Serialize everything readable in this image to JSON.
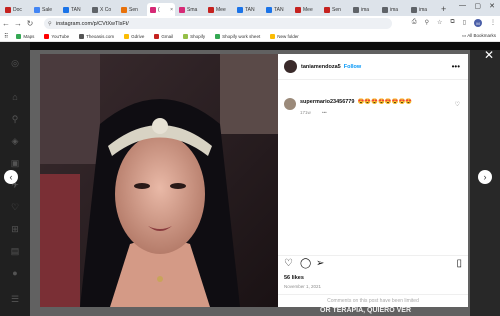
{
  "browser": {
    "tabs": [
      {
        "label": "Doc",
        "color": "#c5221f"
      },
      {
        "label": "Sale",
        "color": "#4285f4"
      },
      {
        "label": "TAN",
        "color": "#1a73e8"
      },
      {
        "label": "X Co",
        "color": "#5f6368"
      },
      {
        "label": "Sen",
        "color": "#e8710a"
      },
      {
        "label": "(",
        "color": "#d62976",
        "active": true,
        "x": "×"
      },
      {
        "label": "Sma",
        "color": "#d62976"
      },
      {
        "label": "Mee",
        "color": "#c5221f"
      },
      {
        "label": "TAN",
        "color": "#1a73e8"
      },
      {
        "label": "TAN",
        "color": "#1a73e8"
      },
      {
        "label": "Mee",
        "color": "#c5221f"
      },
      {
        "label": "Sen",
        "color": "#c5221f"
      },
      {
        "label": "ima",
        "color": "#5f6368"
      },
      {
        "label": "ima",
        "color": "#5f6368"
      },
      {
        "label": "ima",
        "color": "#5f6368"
      }
    ],
    "url": "instagram.com/p/CVtXwTlsFt/",
    "bookmarks": [
      {
        "label": "Maps",
        "color": "#34a853"
      },
      {
        "label": "YouTube",
        "color": "#ff0000"
      },
      {
        "label": "Theoasis.com",
        "color": "#555"
      },
      {
        "label": "Gdrive",
        "color": "#fbbc04"
      },
      {
        "label": "Gmail",
        "color": "#c5221f"
      },
      {
        "label": "Shopify",
        "color": "#95bf47"
      },
      {
        "label": "Shopify work sheet",
        "color": "#34a853"
      },
      {
        "label": "New folder",
        "color": "#fbbc04"
      }
    ],
    "all_bookmarks": "All Bookmarks"
  },
  "post": {
    "username": "taniamendoza5",
    "follow": "Follow",
    "comment": {
      "user": "supermario23456779",
      "text": "😍😍😍😍😍😍😍😍",
      "time": "171w",
      "more": "•••"
    },
    "likes": "56 likes",
    "date": "November 1, 2021",
    "comments_limited": "Comments on this post have been limited"
  },
  "background_text": "OR TERAPIA, QUIERO VER"
}
